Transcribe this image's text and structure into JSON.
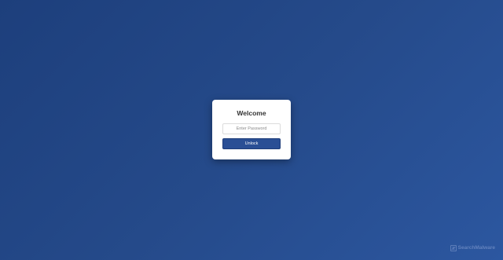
{
  "dialog": {
    "title": "Welcome",
    "password_placeholder": "Enter Password",
    "password_value": "",
    "unlock_label": "Unlock"
  },
  "watermark": {
    "logo_icon": "sensor-malware-logo-icon",
    "text": "SearchMalware"
  },
  "colors": {
    "background_start": "#1d3f7c",
    "background_end": "#2c57a0",
    "button": "#2a4f95",
    "card": "#ffffff"
  }
}
